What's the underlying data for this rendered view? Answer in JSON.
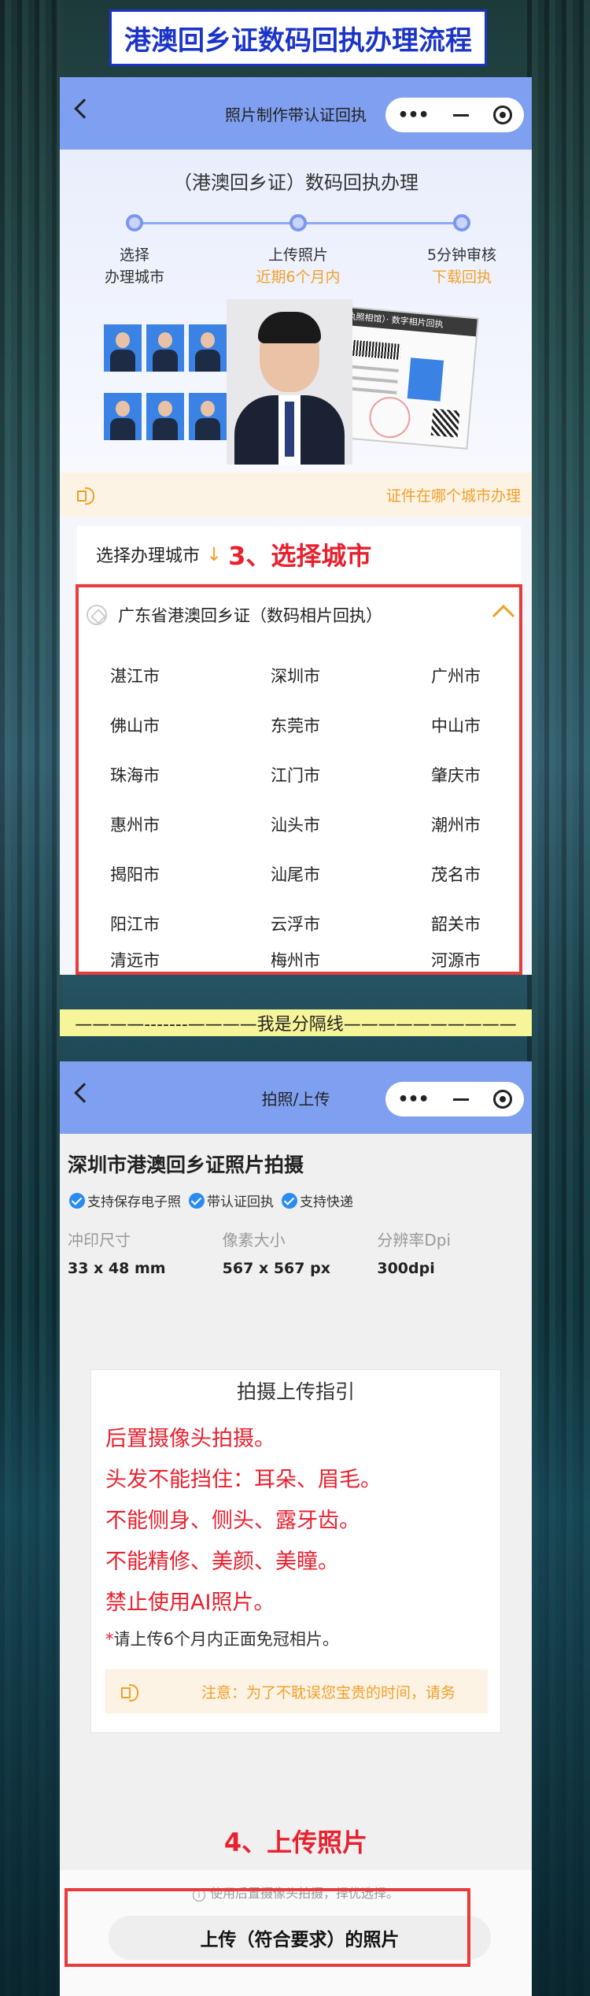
{
  "page_title": "港澳回乡证数码回执办理流程",
  "colors": {
    "title_blue": "#1b34c8",
    "nav_blue": "#7f9ff0",
    "accent_orange": "#f1a02b",
    "highlight_red": "#e8212f",
    "divider_yellow": "#f7f59a"
  },
  "screen1": {
    "nav_title": "照片制作带认证回执",
    "hero_title": "（港澳回乡证）数码回执办理",
    "steps": [
      {
        "title": "选择",
        "sub": "办理城市"
      },
      {
        "title": "上传照片",
        "sub": "近期6个月内"
      },
      {
        "title": "5分钟审核",
        "sub": "下载回执"
      }
    ],
    "receipt_header": "回执照相馆）· 数字相片回执",
    "notice_link": "证件在哪个城市办理",
    "select_label": "选择办理城市",
    "select_arrow": "↓",
    "step_annotation": "3、选择城市",
    "province": "广东省港澳回乡证（数码相片回执）",
    "cities": [
      "湛江市",
      "深圳市",
      "广州市",
      "佛山市",
      "东莞市",
      "中山市",
      "珠海市",
      "江门市",
      "肇庆市",
      "惠州市",
      "汕头市",
      "潮州市",
      "揭阳市",
      "汕尾市",
      "茂名市",
      "阳江市",
      "云浮市",
      "韶关市",
      "清远市",
      "梅州市",
      "河源市"
    ]
  },
  "divider_text": "————-------————我是分隔线——————————",
  "screen2": {
    "nav_title": "拍照/上传",
    "page_title": "深圳市港澳回乡证照片拍摄",
    "features": [
      "支持保存电子照",
      "带认证回执",
      "支持快递"
    ],
    "specs": [
      {
        "label": "冲印尺寸",
        "value": "33 x 48 mm"
      },
      {
        "label": "像素大小",
        "value": "567 x 567 px"
      },
      {
        "label": "分辨率Dpi",
        "value": "300dpi"
      }
    ],
    "guide_title": "拍摄上传指引",
    "guide_items": [
      "后置摄像头拍摄。",
      "头发不能挡住：耳朵、眉毛。",
      "不能侧身、侧头、露牙齿。",
      "不能精修、美颜、美瞳。",
      "禁止使用AI照片。"
    ],
    "guide_note_star": "*",
    "guide_note": "请上传6个月内正面免冠相片。",
    "guide_tip": "注意：为了不耽误您宝贵的时间，请务",
    "step_annotation": "4、上传照片",
    "hint": "使用后置摄像头拍摄，择优选择。",
    "upload_button": "上传（符合要求）的照片"
  }
}
